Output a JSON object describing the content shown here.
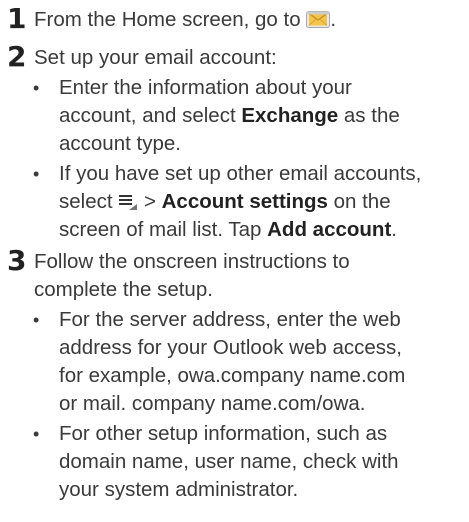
{
  "steps": [
    {
      "number": "1",
      "text_before_icon": "From the Home screen, go to",
      "text_after_icon": ".",
      "icon": "email-app-icon"
    },
    {
      "number": "2",
      "text": "Set up your email account:",
      "bullets": [
        {
          "lines": [
            "Enter the information about your",
            {
              "before": "account, and select ",
              "bold": "Exchange",
              "after": " as the"
            },
            "account type."
          ]
        },
        {
          "lines": [
            "If you have set up other email accounts,",
            {
              "before": "select ",
              "icon": "menu-icon",
              "mid": " > ",
              "bold": "Account settings",
              "after": " on the"
            },
            {
              "before": "screen of mail list. Tap ",
              "bold": "Add account",
              "after": "."
            }
          ]
        }
      ]
    },
    {
      "number": "3",
      "lines": [
        "Follow the onscreen instructions to",
        "complete the setup."
      ],
      "bullets": [
        {
          "lines": [
            "For the server address, enter the web",
            "address for your Outlook web access,",
            "for example, owa.company name.com",
            "or mail. company name.com/owa."
          ]
        },
        {
          "lines": [
            "For other setup information, such as",
            "domain name, user name, check with",
            "your system administrator."
          ]
        }
      ]
    }
  ],
  "bullet_char": "•"
}
